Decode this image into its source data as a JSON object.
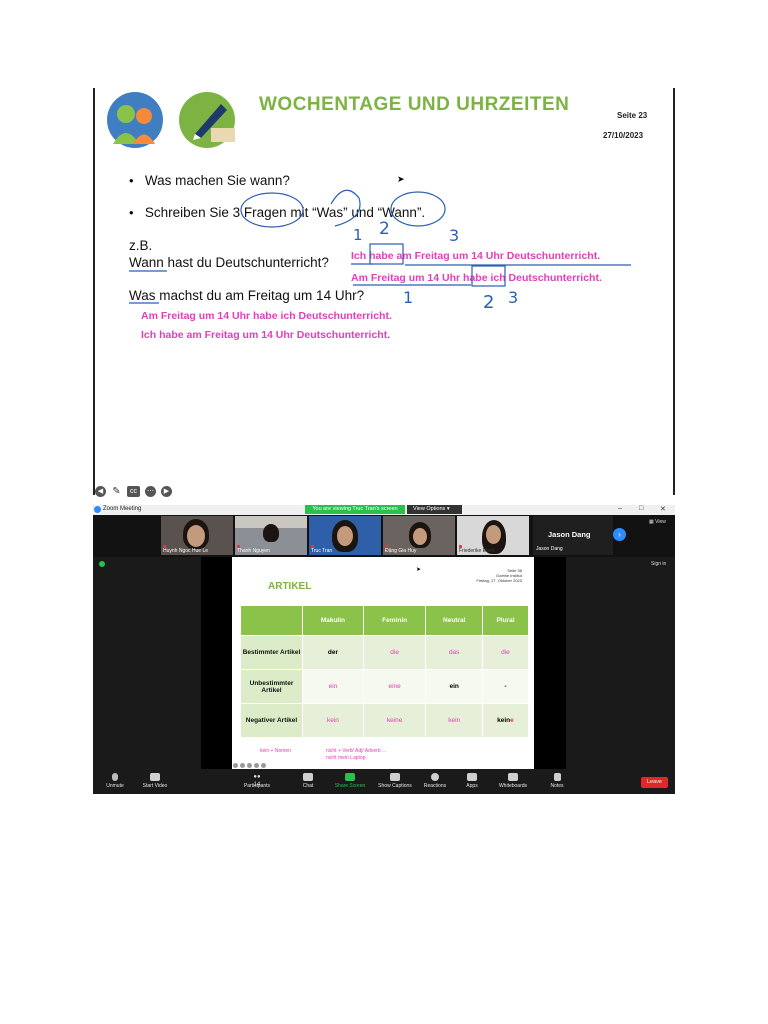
{
  "slide1": {
    "title": "WOCHENTAGE UND UHRZEITEN",
    "page": "Seite 23",
    "date": "27/10/2023",
    "bullet1": "Was machen Sie wann?",
    "bullet2": "Schreiben Sie 3 Fragen mit “Was” und “Wann”.",
    "zb": "z.B.",
    "q1": "Wann hast du Deutschunterricht?",
    "q2": "Was machst du am Freitag um 14 Uhr?",
    "a1": "Ich habe am Freitag um 14 Uhr Deutschunterricht.",
    "a2": "Am Freitag um 14 Uhr habe ich Deutschunterricht.",
    "a3": "Am Freitag um 14 Uhr habe ich Deutschunterricht.",
    "a4": "Ich habe am Freitag um 14 Uhr Deutschunterricht.",
    "hand_numbers": {
      "n1": "1",
      "n2": "2",
      "n3": "3",
      "n4": "1",
      "n5": "2",
      "n6": "3"
    },
    "toolbar_icons": [
      "arrow-left-icon",
      "pen-icon",
      "cc-icon",
      "more-icon",
      "arrow-right-icon"
    ]
  },
  "zoom": {
    "window_title": "Zoom Meeting",
    "banner": "You are viewing Truc Tran's screen",
    "view_options": "View Options",
    "win_controls": {
      "min": "–",
      "max": "□",
      "close": "✕"
    },
    "participants": [
      {
        "name": "Huynh Ngoc Hue Le"
      },
      {
        "name": "Thanh Nguyen"
      },
      {
        "name": "Truc Tran"
      },
      {
        "name": "Đặng Gia Huy"
      },
      {
        "name": "Friederike Ebert"
      }
    ],
    "active_speaker": "Jason Dang",
    "active_speaker_small": "Jason Dang",
    "view_label": "View",
    "sign_in": "Sign in",
    "slide2": {
      "title": "ARTIKEL",
      "meta": [
        "Seite 36",
        "Goethe Institut",
        "Freitag, 27. Oktober 2023"
      ],
      "headers": [
        "",
        "Makulin",
        "Feminin",
        "Neutral",
        "Plural"
      ],
      "rows": [
        {
          "label": "Bestimmter Artikel",
          "cells": [
            "der",
            "die",
            "das",
            "die"
          ]
        },
        {
          "label": "Unbestimmter Artikel",
          "cells": [
            "ein",
            "eine",
            "ein",
            "-"
          ]
        },
        {
          "label": "Negativer Artikel",
          "cells": [
            "kein",
            "keine",
            "kein",
            "keine"
          ]
        }
      ],
      "note1": "kein + Nomen",
      "note2a": "nicht  + Verb/ Adj/ Adverb ...",
      "note2b": "nicht mein Laptop"
    },
    "bottom_bar": [
      {
        "label": "Unmute",
        "icon": "mic-off-icon"
      },
      {
        "label": "Start Video",
        "icon": "video-off-icon"
      },
      {
        "label": "Participants",
        "icon": "participants-icon",
        "count": "14"
      },
      {
        "label": "Chat",
        "icon": "chat-icon"
      },
      {
        "label": "Share Screen",
        "icon": "share-screen-icon"
      },
      {
        "label": "Show Captions",
        "icon": "captions-icon"
      },
      {
        "label": "Reactions",
        "icon": "reactions-icon"
      },
      {
        "label": "Apps",
        "icon": "apps-icon"
      },
      {
        "label": "Whiteboards",
        "icon": "whiteboard-icon"
      },
      {
        "label": "Notes",
        "icon": "notes-icon"
      }
    ],
    "leave": "Leave"
  }
}
